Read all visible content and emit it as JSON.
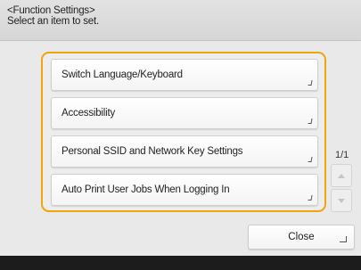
{
  "header": {
    "title": "<Function Settings>",
    "subtitle": "Select an item to set."
  },
  "items": [
    {
      "label": "Switch Language/Keyboard"
    },
    {
      "label": "Accessibility"
    },
    {
      "label": "Personal SSID and Network Key Settings"
    },
    {
      "label": "Auto Print User Jobs When Logging In"
    }
  ],
  "pagination": {
    "indicator": "1/1"
  },
  "actions": {
    "close_label": "Close"
  },
  "colors": {
    "focus_border": "#f0a50a",
    "footer": "#1c1c1c"
  }
}
